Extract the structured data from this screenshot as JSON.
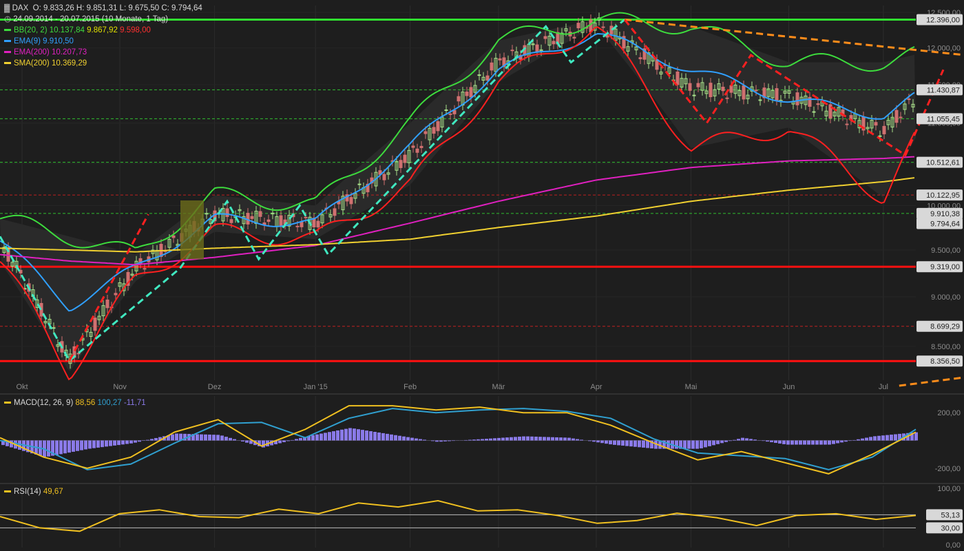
{
  "header": {
    "symbol": "DAX",
    "ohlc": "O: 9.833,26  H: 9.851,31  L: 9.675,50  C: 9.794,64",
    "range": "24.09.2014 - 20.07.2015 (10 Monate, 1 Tag)"
  },
  "indicators": [
    {
      "label": "BB(20, 2)",
      "values": [
        "10.137,84",
        "9.867,92",
        "9.598,00"
      ],
      "colors": [
        "#3ddc3d",
        "#e0e000",
        "#ff3030"
      ]
    },
    {
      "label": "EMA(9)",
      "values": [
        "9.910,50"
      ],
      "colors": [
        "#30a0ff"
      ]
    },
    {
      "label": "EMA(200)",
      "values": [
        "10.207,73"
      ],
      "colors": [
        "#e020c0"
      ]
    },
    {
      "label": "SMA(200)",
      "values": [
        "10.369,29"
      ],
      "colors": [
        "#f0d030"
      ]
    }
  ],
  "macd_legend": {
    "label": "MACD(12, 26, 9)",
    "values": [
      "88,56",
      "100,27",
      "-11,71"
    ]
  },
  "rsi_legend": {
    "label": "RSI(14)",
    "value": "49,67"
  },
  "colors": {
    "background": "#1e1e1e",
    "bb_upper": "#3ddc3d",
    "bb_lower": "#ff2020",
    "ema9": "#30a0ff",
    "ema200": "#e020c0",
    "sma200": "#f0d030",
    "support_line": "#ff1010",
    "resistance_line": "#30e030",
    "pattern": "#40e8c0",
    "trend_red": "#ff2020",
    "trend_orange": "#ff8c1a",
    "macd_hist": "#8a7ae8",
    "rsi_line": "#f0c020"
  },
  "chart_data": [
    {
      "type": "line",
      "title": "DAX",
      "x": [
        "2014-09-24",
        "2014-10-16",
        "2014-11-06",
        "2014-12-01",
        "2015-01-02",
        "2015-02-01",
        "2015-03-01",
        "2015-04-01",
        "2015-05-01",
        "2015-06-01",
        "2015-07-01",
        "2015-07-20"
      ],
      "xticks": [
        "Okt",
        "Nov",
        "Dez",
        "Jan '15",
        "Feb",
        "Mär",
        "Apr",
        "Mai",
        "Jun",
        "Jul"
      ],
      "ylim": [
        8200,
        12600
      ],
      "yscale": "log",
      "yticks": [
        "12.500,00",
        "12.000,00",
        "11.500,00",
        "11.000,00",
        "10.500,00",
        "10.000,00",
        "9.500,00",
        "9.000,00",
        "8.500,00"
      ],
      "series": [
        {
          "name": "DAX",
          "values": [
            9600,
            8360,
            9300,
            9900,
            9800,
            10600,
            11800,
            12350,
            11450,
            11350,
            10900,
            11700
          ]
        },
        {
          "name": "BB(20, 2)",
          "values": [
            9850,
            9650,
            9450,
            10120,
            10000,
            11000,
            12100,
            12396,
            12300,
            11800,
            11800,
            12000
          ]
        },
        {
          "name": "EMA(9)",
          "values": [
            9600,
            8900,
            9300,
            9850,
            9800,
            10700,
            11700,
            12200,
            11700,
            11300,
            11100,
            11550
          ]
        },
        {
          "name": "EMA(200)",
          "values": [
            9450,
            9380,
            9340,
            9420,
            9550,
            9800,
            10050,
            10300,
            10450,
            10530,
            10560,
            10600
          ]
        },
        {
          "name": "SMA(200)",
          "values": [
            9520,
            9500,
            9480,
            9520,
            9560,
            9620,
            9750,
            9880,
            10050,
            10180,
            10280,
            10370
          ]
        }
      ],
      "price_labels": [
        "12.396,00",
        "11.430,87",
        "11.055,45",
        "10.512,61",
        "10.122,95",
        "9.910,38",
        "9.794,64",
        "9.319,00",
        "8.699,29",
        "8.356,50"
      ],
      "horizontal_lines": [
        {
          "value": 12396,
          "style": "solid",
          "color": "#30e030"
        },
        {
          "value": 11430.87,
          "style": "dashed",
          "color": "#30c030"
        },
        {
          "value": 11055.45,
          "style": "dashed",
          "color": "#30c030"
        },
        {
          "value": 10512.61,
          "style": "dashed",
          "color": "#30c030"
        },
        {
          "value": 10122.95,
          "style": "dashed",
          "color": "#c02020"
        },
        {
          "value": 9910.38,
          "style": "dashed",
          "color": "#30c030"
        },
        {
          "value": 9319,
          "style": "solid",
          "color": "#ff1010"
        },
        {
          "value": 8699.29,
          "style": "dashed",
          "color": "#c02020"
        },
        {
          "value": 8356.5,
          "style": "solid",
          "color": "#ff1010"
        }
      ]
    },
    {
      "type": "bar",
      "title": "MACD(12, 26, 9)",
      "yticks": [
        "200,00",
        "-200,00"
      ],
      "ylim": [
        -300,
        320
      ],
      "macd": [
        20,
        -120,
        -200,
        -120,
        60,
        150,
        -40,
        80,
        250,
        250,
        220,
        240,
        200,
        200,
        110,
        -20,
        -140,
        -80,
        -160,
        -240,
        -100,
        60
      ],
      "signal": [
        0,
        -60,
        -210,
        -170,
        -20,
        120,
        130,
        20,
        160,
        230,
        200,
        220,
        230,
        210,
        160,
        10,
        -90,
        -110,
        -130,
        -210,
        -120,
        80
      ],
      "histogram": [
        -30,
        -120,
        -60,
        -20,
        50,
        40,
        -50,
        30,
        90,
        40,
        -10,
        10,
        30,
        20,
        -30,
        -60,
        -60,
        20,
        -30,
        -30,
        30,
        60
      ]
    },
    {
      "type": "line",
      "title": "RSI(14)",
      "yticks": [
        "100,00",
        "53,13",
        "30,00",
        "0,00"
      ],
      "ylim": [
        0,
        100
      ],
      "values": [
        50,
        30,
        24,
        55,
        62,
        50,
        48,
        63,
        55,
        74,
        67,
        78,
        60,
        62,
        52,
        38,
        43,
        56,
        48,
        34,
        52,
        55,
        45,
        52
      ]
    }
  ]
}
